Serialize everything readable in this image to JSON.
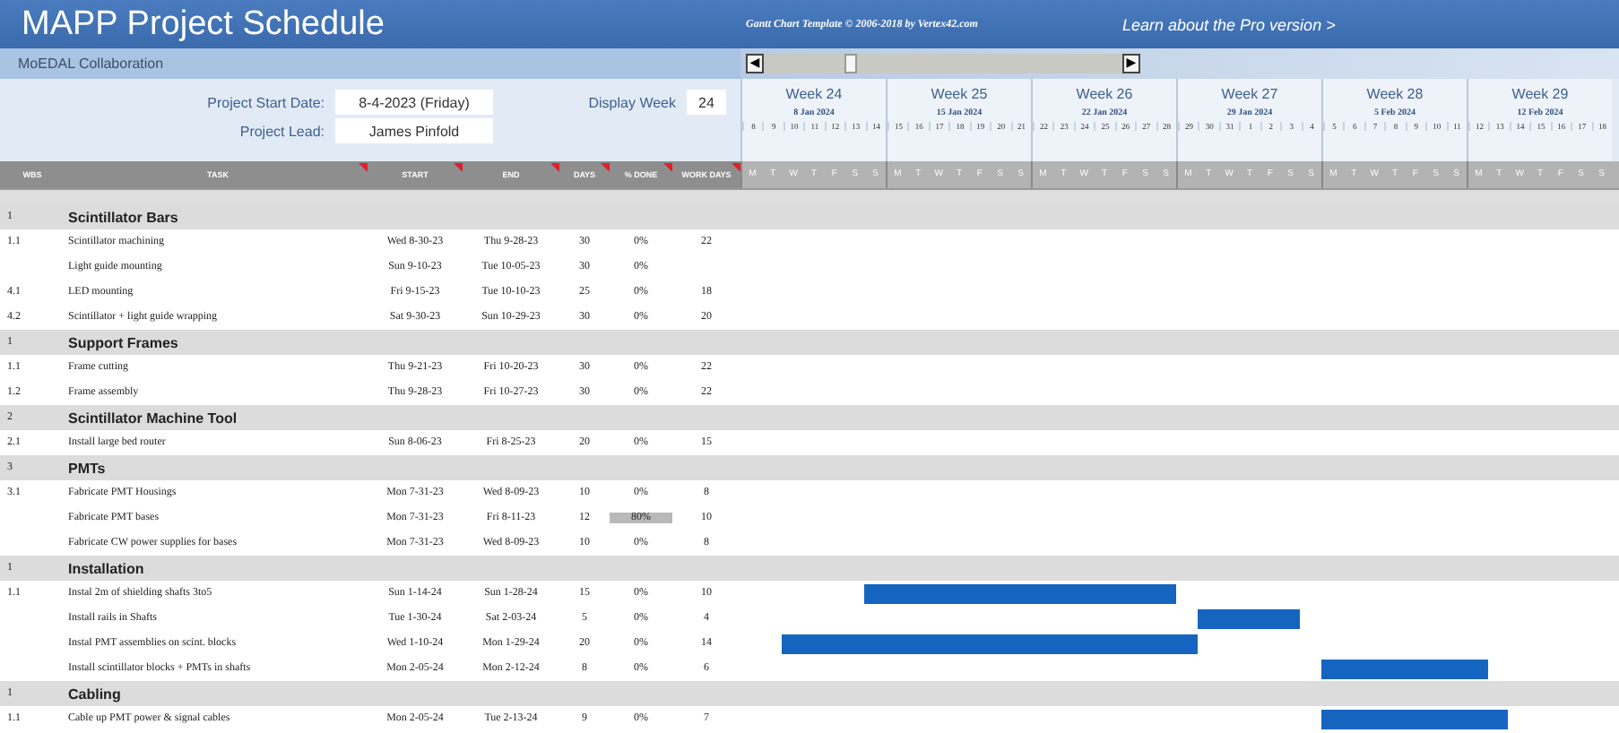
{
  "title": "MAPP Project Schedule",
  "credit": "Gantt Chart Template © 2006-2018 by Vertex42.com",
  "pro_link": "Learn about the Pro version >",
  "subtitle": "MoEDAL Collaboration",
  "fields": [
    {
      "label": "Project Start Date:",
      "value": "8-4-2023 (Friday)"
    },
    {
      "label": "Project Lead:",
      "value": "James Pinfold"
    }
  ],
  "display_week": {
    "label": "Display Week",
    "value": "24"
  },
  "scrollbar": {
    "left": "◀",
    "right": "▶"
  },
  "columns": [
    "WBS",
    "TASK",
    "START",
    "END",
    "DAYS",
    "% DONE",
    "WORK DAYS"
  ],
  "weeks": [
    {
      "label": "Week 24",
      "date": "8 Jan 2024",
      "days": [
        "8",
        "9",
        "10",
        "11",
        "12",
        "13",
        "14"
      ],
      "letters": [
        "M",
        "T",
        "W",
        "T",
        "F",
        "S",
        "S"
      ]
    },
    {
      "label": "Week 25",
      "date": "15 Jan 2024",
      "days": [
        "15",
        "16",
        "17",
        "18",
        "19",
        "20",
        "21"
      ],
      "letters": [
        "M",
        "T",
        "W",
        "T",
        "F",
        "S",
        "S"
      ]
    },
    {
      "label": "Week 26",
      "date": "22 Jan 2024",
      "days": [
        "22",
        "23",
        "24",
        "25",
        "26",
        "27",
        "28"
      ],
      "letters": [
        "M",
        "T",
        "W",
        "T",
        "F",
        "S",
        "S"
      ]
    },
    {
      "label": "Week 27",
      "date": "29 Jan 2024",
      "days": [
        "29",
        "30",
        "31",
        "1",
        "2",
        "3",
        "4"
      ],
      "letters": [
        "M",
        "T",
        "W",
        "T",
        "F",
        "S",
        "S"
      ]
    },
    {
      "label": "Week 28",
      "date": "5 Feb 2024",
      "days": [
        "5",
        "6",
        "7",
        "8",
        "9",
        "10",
        "11"
      ],
      "letters": [
        "M",
        "T",
        "W",
        "T",
        "F",
        "S",
        "S"
      ]
    },
    {
      "label": "Week 29",
      "date": "12 Feb 2024",
      "days": [
        "12",
        "13",
        "14",
        "15",
        "16",
        "17",
        "18"
      ],
      "letters": [
        "M",
        "T",
        "W",
        "T",
        "F",
        "S",
        "S"
      ]
    }
  ],
  "rows": [
    {
      "kind": "group",
      "wbs": "1",
      "task": "Scintillator Bars"
    },
    {
      "kind": "task",
      "wbs": "1.1",
      "task": "Scintillator machining",
      "start": "Wed 8-30-23",
      "end": "Thu 9-28-23",
      "days": "30",
      "done": "0%",
      "work_days": "22",
      "highlight": false
    },
    {
      "kind": "task",
      "task": "Light guide mounting",
      "start": "Sun 9-10-23",
      "end": "Tue 10-05-23",
      "days": "30",
      "done": "0%",
      "highlight": false
    },
    {
      "kind": "task",
      "wbs": "4.1",
      "task": "LED mounting",
      "start": "Fri 9-15-23",
      "end": "Tue 10-10-23",
      "days": "25",
      "done": "0%",
      "work_days": "18",
      "highlight": false
    },
    {
      "kind": "task",
      "wbs": "4.2",
      "task": "Scintillator + light guide wrapping",
      "start": "Sat 9-30-23",
      "end": "Sun 10-29-23",
      "days": "30",
      "done": "0%",
      "work_days": "20",
      "highlight": false
    },
    {
      "kind": "group",
      "wbs": "1",
      "task": "Support Frames"
    },
    {
      "kind": "task",
      "wbs": "1.1",
      "task": "Frame cutting",
      "start": "Thu 9-21-23",
      "end": "Fri 10-20-23",
      "days": "30",
      "done": "0%",
      "work_days": "22",
      "highlight": false
    },
    {
      "kind": "task",
      "wbs": "1.2",
      "task": "Frame assembly",
      "start": "Thu 9-28-23",
      "end": "Fri 10-27-23",
      "days": "30",
      "done": "0%",
      "work_days": "22",
      "highlight": false
    },
    {
      "kind": "group",
      "wbs": "2",
      "task": "Scintillator Machine Tool"
    },
    {
      "kind": "task",
      "wbs": "2.1",
      "task": "Install large bed router",
      "start": "Sun 8-06-23",
      "end": "Fri 8-25-23",
      "days": "20",
      "done": "0%",
      "work_days": "15",
      "highlight": false
    },
    {
      "kind": "group",
      "wbs": "3",
      "task": "PMTs"
    },
    {
      "kind": "task",
      "wbs": "3.1",
      "task": "Fabricate PMT Housings",
      "start": "Mon 7-31-23",
      "end": "Wed 8-09-23",
      "days": "10",
      "done": "0%",
      "work_days": "8",
      "highlight": false
    },
    {
      "kind": "task",
      "task": "Fabricate PMT bases",
      "start": "Mon 7-31-23",
      "end": "Fri 8-11-23",
      "days": "12",
      "done": "80%",
      "work_days": "10",
      "highlight": true
    },
    {
      "kind": "task",
      "task": "Fabricate CW power supplies for bases",
      "start": "Mon 7-31-23",
      "end": "Wed 8-09-23",
      "days": "10",
      "done": "0%",
      "work_days": "8",
      "highlight": false
    },
    {
      "kind": "group",
      "wbs": "1",
      "task": "Installation"
    },
    {
      "kind": "task",
      "wbs": "1.1",
      "task": "Instal 2m of shielding shafts 3to5",
      "start": "Sun 1-14-24",
      "end": "Sun 1-28-24",
      "days": "15",
      "done": "0%",
      "work_days": "10",
      "highlight": false
    },
    {
      "kind": "task",
      "task": "Install rails in Shafts",
      "start": "Tue 1-30-24",
      "end": "Sat 2-03-24",
      "days": "5",
      "done": "0%",
      "work_days": "4",
      "highlight": false
    },
    {
      "kind": "task",
      "task": "Instal PMT assemblies on scint. blocks",
      "start": "Wed 1-10-24",
      "end": "Mon 1-29-24",
      "days": "20",
      "done": "0%",
      "work_days": "14",
      "highlight": false
    },
    {
      "kind": "task",
      "task": "Install scintillator blocks + PMTs in shafts",
      "start": "Mon 2-05-24",
      "end": "Mon 2-12-24",
      "days": "8",
      "done": "0%",
      "work_days": "6",
      "highlight": false
    },
    {
      "kind": "group",
      "wbs": "1",
      "task": "Cabling"
    },
    {
      "kind": "task",
      "wbs": "1.1",
      "task": "Cable up PMT power & signal cables",
      "start": "Mon 2-05-24",
      "end": "Tue 2-13-24",
      "days": "9",
      "done": "0%",
      "work_days": "7",
      "highlight": false
    }
  ]
}
